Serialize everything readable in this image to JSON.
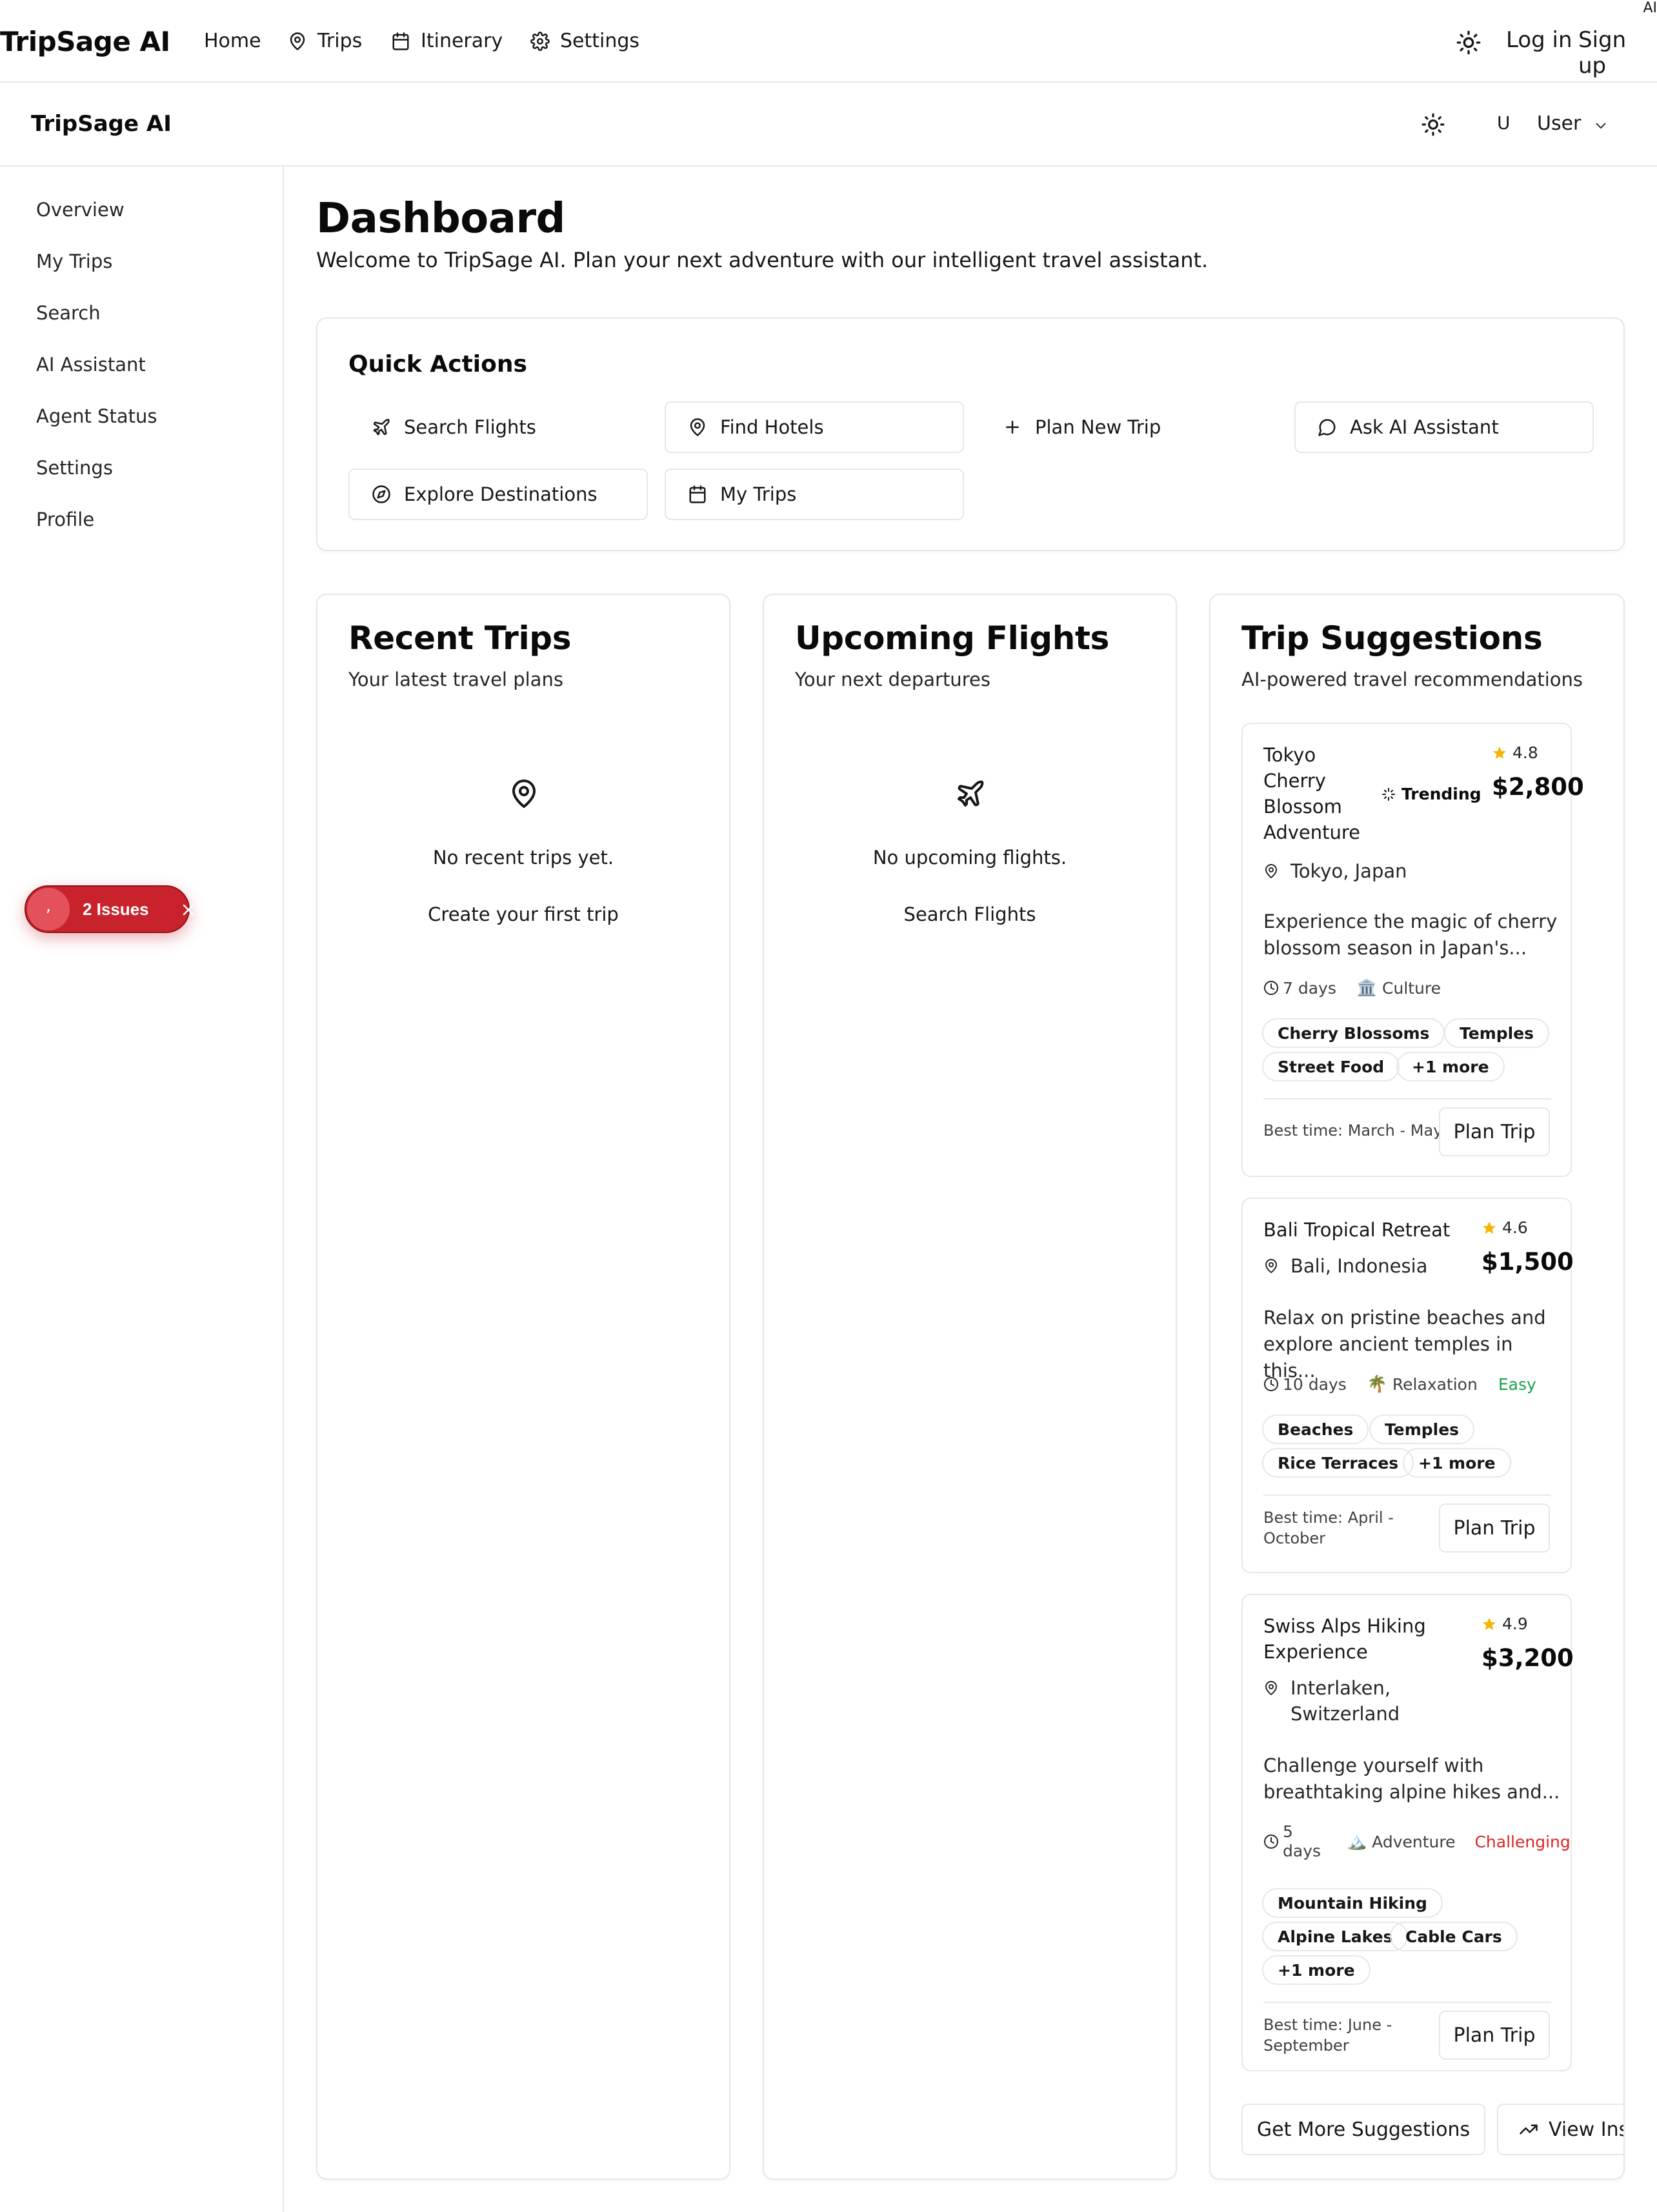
{
  "topnav": {
    "brand": "TripSage AI",
    "links": [
      "Home",
      "Trips",
      "Itinerary",
      "Settings"
    ],
    "corner_label": "AI",
    "login": "Log in",
    "signup": "Sign up"
  },
  "header": {
    "brand": "TripSage AI",
    "avatar_initial": "U",
    "user_name": "User"
  },
  "sidebar": {
    "items": [
      "Overview",
      "My Trips",
      "Search",
      "AI Assistant",
      "Agent Status",
      "Settings",
      "Profile"
    ]
  },
  "dashboard": {
    "title": "Dashboard",
    "subtitle": "Welcome to TripSage AI. Plan your next adventure with our intelligent travel assistant."
  },
  "quick_actions": {
    "title": "Quick Actions",
    "buttons": [
      "Search Flights",
      "Find Hotels",
      "Plan New Trip",
      "Ask AI Assistant",
      "Explore Destinations",
      "My Trips"
    ]
  },
  "recent_trips": {
    "title": "Recent Trips",
    "subtitle": "Your latest travel plans",
    "empty": "No recent trips yet.",
    "action": "Create your first trip"
  },
  "upcoming_flights": {
    "title": "Upcoming Flights",
    "subtitle": "Your next departures",
    "empty": "No upcoming flights.",
    "action": "Search Flights"
  },
  "suggestions": {
    "title": "Trip Suggestions",
    "subtitle": "AI-powered travel recommendations",
    "items": [
      {
        "name_lines": [
          "Tokyo",
          "Cherry",
          "Blossom",
          "Adventure"
        ],
        "trending": "Trending",
        "rating": "4.8",
        "price": "$2,800",
        "location": "Tokyo, Japan",
        "desc_lines": [
          "Experience the magic of cherry",
          "blossom season in Japan's..."
        ],
        "duration": "7 days",
        "category": "Culture",
        "category_emoji": "🏛️",
        "difficulty": "",
        "tags": [
          "Cherry Blossoms",
          "Temples",
          "Street Food",
          "+1 more"
        ],
        "best_time": "Best time: March - May",
        "plan": "Plan Trip"
      },
      {
        "name_lines": [
          "Bali Tropical Retreat"
        ],
        "rating": "4.6",
        "price": "$1,500",
        "location": "Bali, Indonesia",
        "desc_lines": [
          "Relax on pristine beaches and",
          "explore ancient temples in this..."
        ],
        "duration": "10 days",
        "category": "Relaxation",
        "category_emoji": "🌴",
        "difficulty": "Easy",
        "tags": [
          "Beaches",
          "Temples",
          "Rice Terraces",
          "+1 more"
        ],
        "best_time_lines": [
          "Best time: April -",
          "October"
        ],
        "plan": "Plan Trip"
      },
      {
        "name_lines": [
          "Swiss Alps Hiking",
          "Experience"
        ],
        "rating": "4.9",
        "price": "$3,200",
        "location_lines": [
          "Interlaken,",
          "Switzerland"
        ],
        "desc_lines": [
          "Challenge yourself with",
          "breathtaking alpine hikes and..."
        ],
        "duration_lines": [
          "5",
          "days"
        ],
        "category": "Adventure",
        "category_emoji": "🏔️",
        "difficulty": "Challenging",
        "tags": [
          "Mountain Hiking",
          "Alpine Lakes",
          "Cable Cars",
          "+1 more"
        ],
        "best_time_lines": [
          "Best time: June -",
          "September"
        ],
        "plan": "Plan Trip"
      }
    ],
    "more_button": "Get More Suggestions",
    "insights_button": "View Insights"
  },
  "issues_badge": {
    "dot": ",",
    "label": "2 Issues"
  },
  "colors": {
    "easy": "#16a34a",
    "challenging": "#dc2626",
    "star": "#f5b400",
    "issues": "#c8232c"
  }
}
